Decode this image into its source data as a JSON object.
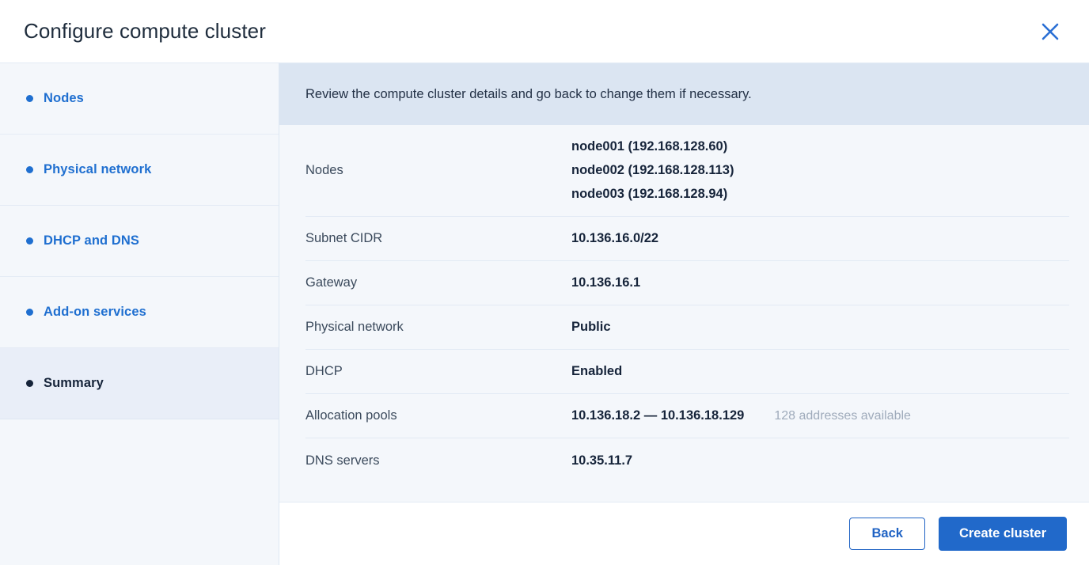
{
  "header": {
    "title": "Configure compute cluster",
    "close_icon": "close-icon",
    "close_color": "#2a6fd4"
  },
  "sidebar": {
    "items": [
      {
        "label": "Nodes",
        "active": false
      },
      {
        "label": "Physical network",
        "active": false
      },
      {
        "label": "DHCP and DNS",
        "active": false
      },
      {
        "label": "Add-on services",
        "active": false
      },
      {
        "label": "Summary",
        "active": true
      }
    ]
  },
  "banner": {
    "text": "Review the compute cluster details and go back to change them if necessary."
  },
  "details": {
    "rows": [
      {
        "label": "Nodes",
        "values": [
          "node001 (192.168.128.60)",
          "node002 (192.168.128.113)",
          "node003 (192.168.128.94)"
        ],
        "note": ""
      },
      {
        "label": "Subnet CIDR",
        "values": [
          "10.136.16.0/22"
        ],
        "note": ""
      },
      {
        "label": "Gateway",
        "values": [
          "10.136.16.1"
        ],
        "note": ""
      },
      {
        "label": "Physical network",
        "values": [
          "Public"
        ],
        "note": ""
      },
      {
        "label": "DHCP",
        "values": [
          "Enabled"
        ],
        "note": ""
      },
      {
        "label": "Allocation pools",
        "values": [
          "10.136.18.2 — 10.136.18.129"
        ],
        "note": "128 addresses available"
      },
      {
        "label": "DNS servers",
        "values": [
          "10.35.11.7"
        ],
        "note": ""
      }
    ]
  },
  "footer": {
    "back_label": "Back",
    "create_label": "Create cluster",
    "primary_color": "#2169ca"
  }
}
